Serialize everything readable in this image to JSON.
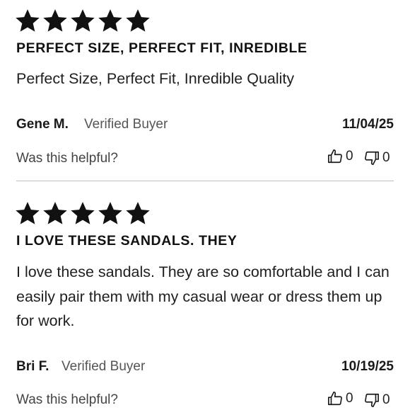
{
  "reviews": [
    {
      "rating": 5,
      "title": "PERFECT SIZE, PERFECT FIT, INREDIBLE",
      "body": "Perfect Size, Perfect Fit, Inredible Quality",
      "author": "Gene M.",
      "verified": "Verified Buyer",
      "date": "11/04/25",
      "helpful_prompt": "Was this helpful?",
      "upvotes": "0",
      "downvotes": "0"
    },
    {
      "rating": 5,
      "title": "I LOVE THESE SANDALS. THEY",
      "body": "I love these sandals. They are so comfortable and I can easily pair them with my casual wear or dress them up for work.",
      "author": "Bri F.",
      "verified": "Verified Buyer",
      "date": "10/19/25",
      "helpful_prompt": "Was this helpful?",
      "upvotes": "0",
      "downvotes": "0"
    }
  ],
  "icons": {
    "star": "star-icon",
    "thumbs_up": "thumbs-up-icon",
    "thumbs_down": "thumbs-down-icon"
  },
  "colors": {
    "star": "#111111",
    "divider": "#bdbdbd"
  }
}
